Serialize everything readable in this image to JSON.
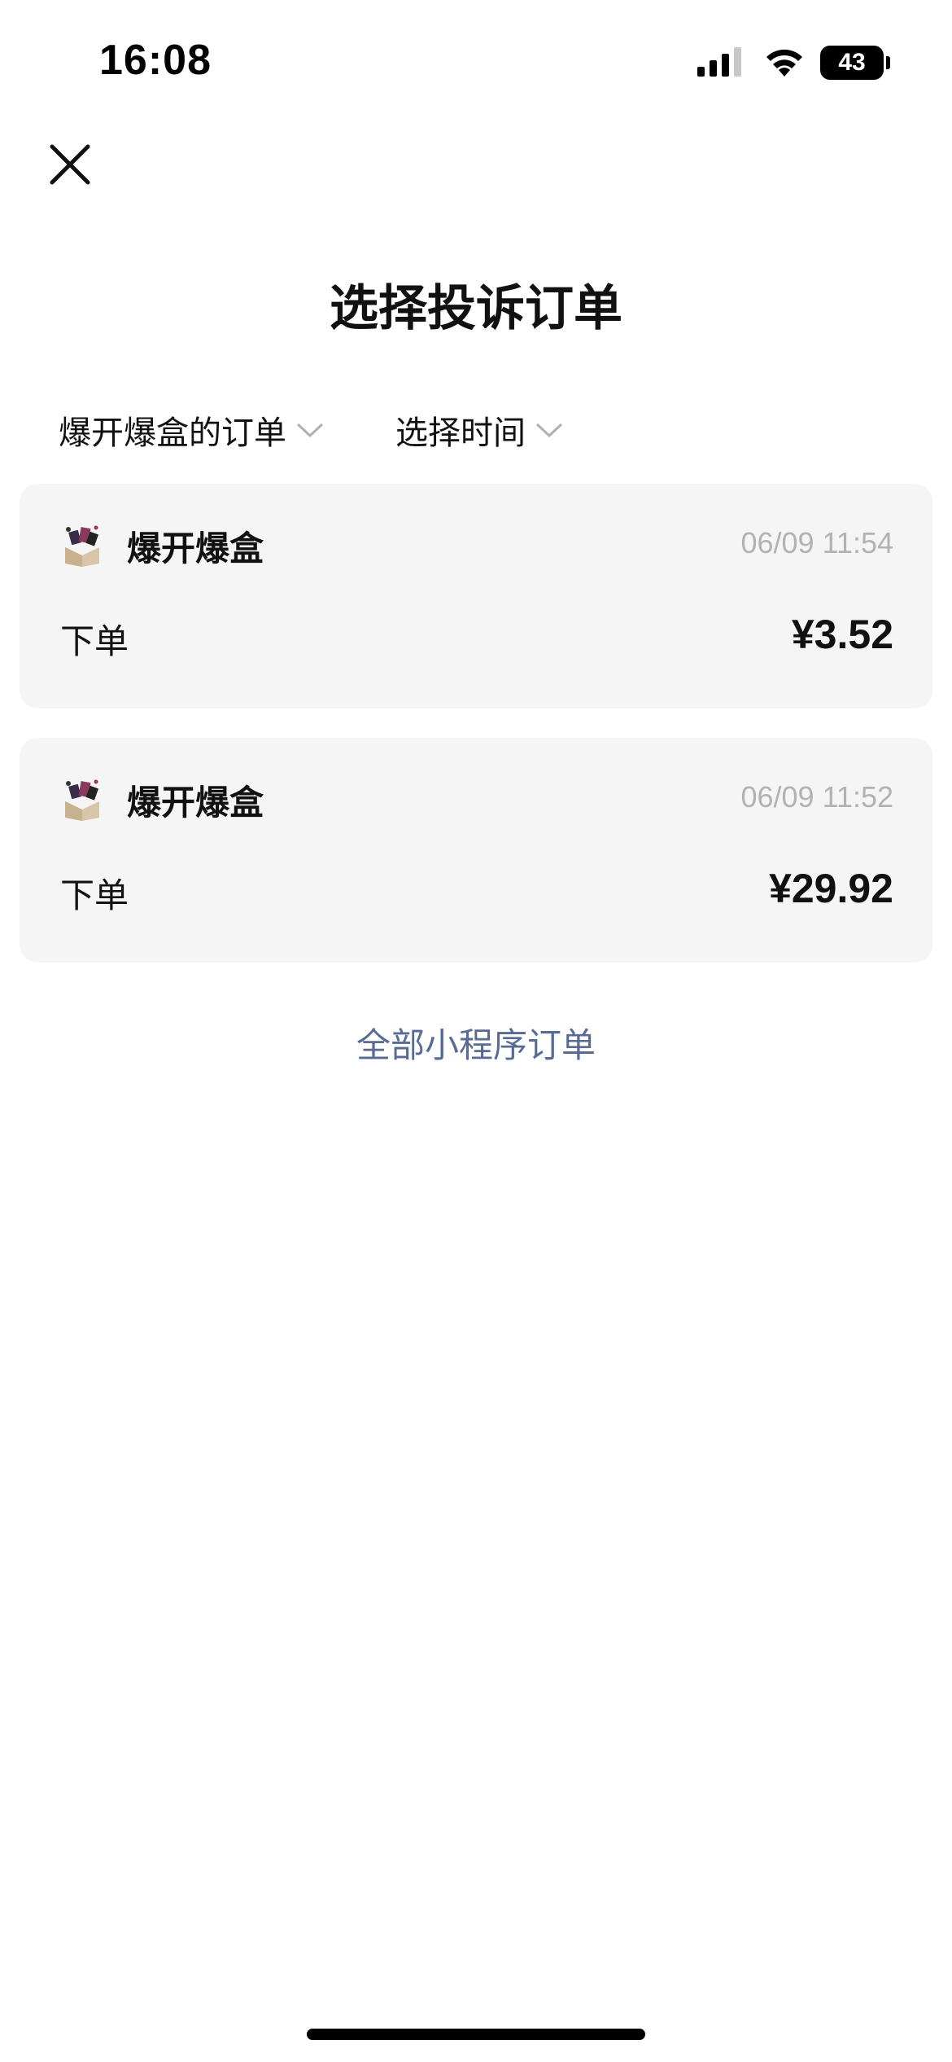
{
  "status_bar": {
    "time": "16:08",
    "battery": "43",
    "icons": [
      "signal-icon",
      "wifi-icon",
      "battery-icon"
    ]
  },
  "header": {
    "close_icon": "close-icon",
    "title": "选择投诉订单"
  },
  "filters": {
    "miniprogram": "爆开爆盒的订单",
    "time": "选择时间",
    "chevron_icon": "chevron-down-icon"
  },
  "orders": [
    {
      "app_name": "爆开爆盒",
      "time": "06/09 11:54",
      "type": "下单",
      "amount": "¥3.52"
    },
    {
      "app_name": "爆开爆盒",
      "time": "06/09 11:52",
      "type": "下单",
      "amount": "¥29.92"
    }
  ],
  "footer_link": "全部小程序订单",
  "colors": {
    "card_bg": "#f5f5f5",
    "link": "#576b95",
    "muted_text": "#b2b2b2",
    "text": "#111111"
  }
}
